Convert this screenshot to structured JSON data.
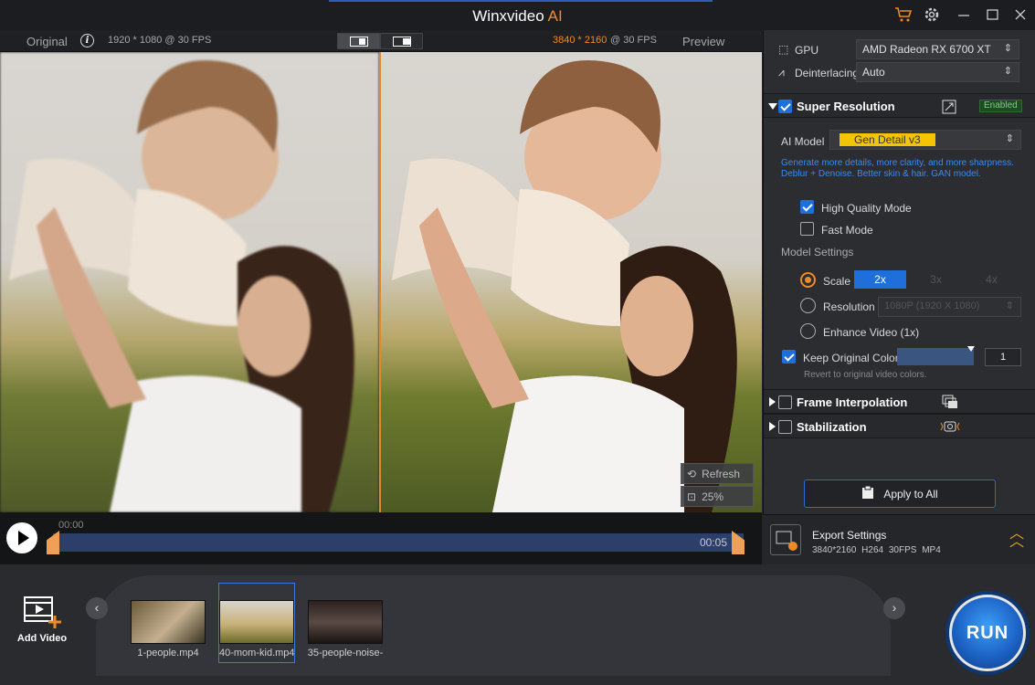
{
  "titlebar": {
    "app_name": "Winxvideo",
    "app_suffix": "AI"
  },
  "viewer": {
    "original_label": "Original",
    "original_info": "1920 * 1080 @ 30 FPS",
    "preview_res": "3840 * 2160",
    "preview_fps": "@ 30 FPS",
    "preview_label": "Preview",
    "refresh_label": "Refresh",
    "zoom_label": "25%"
  },
  "timeline": {
    "start": "00:00",
    "end": "00:05"
  },
  "panel": {
    "gpu_label": "GPU",
    "gpu_value": "AMD Radeon RX 6700 XT",
    "deinterlacing_label": "Deinterlacing",
    "deinterlacing_value": "Auto",
    "super_resolution": {
      "title": "Super Resolution",
      "status": "Enabled",
      "model_label": "AI Model",
      "model_value": "Gen Detail v3",
      "description": "Generate more details, more clarity, and more sharpness. Deblur + Denoise. Better skin & hair. GAN model.",
      "high_quality": "High Quality Mode",
      "fast_mode": "Fast Mode",
      "model_settings": "Model Settings",
      "scale_label": "Scale",
      "scale_options": [
        "2x",
        "3x",
        "4x"
      ],
      "resolution_label": "Resolution",
      "resolution_value": "1080P (1920 X 1080)",
      "enhance_label": "Enhance Video (1x)",
      "keep_colors": "Keep Original Colors",
      "keep_colors_value": "1",
      "keep_colors_hint": "Revert to original video colors."
    },
    "frame_interpolation": "Frame Interpolation",
    "stabilization": "Stabilization",
    "apply_all": "Apply to All"
  },
  "export": {
    "title": "Export Settings",
    "details": "3840*2160 H264 30FPS MP4"
  },
  "bottom": {
    "add_video": "Add Video",
    "files": [
      "1-people.mp4",
      "40-mom-kid.mp4",
      "35-people-noise-"
    ],
    "run_label": "RUN"
  },
  "colors": {
    "accent": "#f08a24",
    "primary": "#1e6fd9",
    "model_highlight": "#f2c500"
  }
}
